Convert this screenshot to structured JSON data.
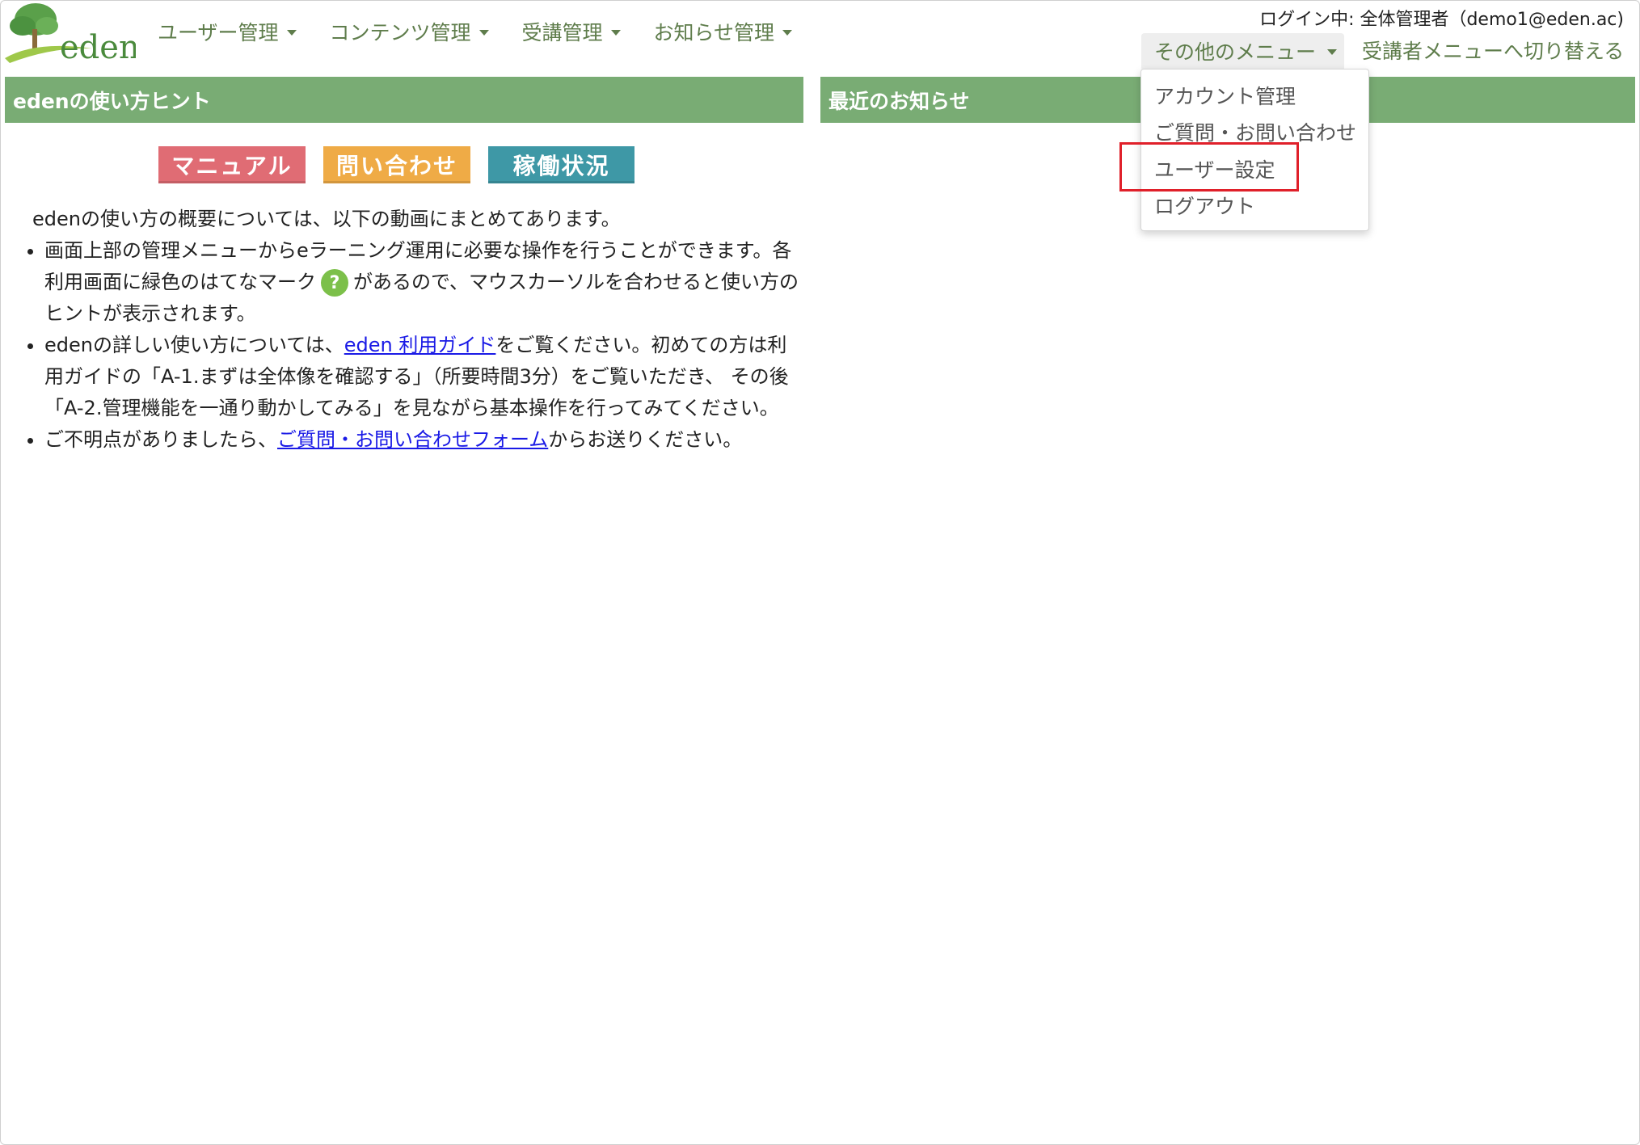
{
  "logo": {
    "text": "eden"
  },
  "nav": [
    {
      "label": "ユーザー管理"
    },
    {
      "label": "コンテンツ管理"
    },
    {
      "label": "受講管理"
    },
    {
      "label": "お知らせ管理"
    }
  ],
  "header": {
    "login_info": "ログイン中: 全体管理者（demo1@eden.ac)",
    "other_menu": "その他のメニュー",
    "switch_link": "受講者メニューへ切り替える"
  },
  "dropdown": {
    "items": [
      {
        "label": "アカウント管理"
      },
      {
        "label": "ご質問・お問い合わせ"
      },
      {
        "label": "ユーザー設定"
      },
      {
        "label": "ログアウト"
      }
    ]
  },
  "left_panel": {
    "title": "edenの使い方ヒント",
    "buttons": [
      {
        "label": "マニュアル",
        "color": "#e06c74"
      },
      {
        "label": "問い合わせ",
        "color": "#efab46"
      },
      {
        "label": "稼働状況",
        "color": "#3e98a6"
      }
    ],
    "intro": "edenの使い方の概要については、以下の動画にまとめてあります。",
    "bullet1": {
      "text_a": "画面上部の管理メニューからeラーニング運用に必要な操作を行うことができます。各利用画面に緑色のはてなマーク",
      "icon_glyph": "?",
      "text_b": "があるので、マウスカーソルを合わせると使い方のヒントが表示されます。"
    },
    "bullet2": {
      "text_a": "edenの詳しい使い方については、",
      "link": "eden 利用ガイド",
      "text_b": "をご覧ください。初めての方は利用ガイドの「A-1.まずは全体像を確認する」（所要時間3分）をご覧いただき、 その後「A-2.管理機能を一通り動かしてみる」を見ながら基本操作を行ってみてください。"
    },
    "bullet3": {
      "text_a": "ご不明点がありましたら、",
      "link": "ご質問・お問い合わせフォーム",
      "text_b": "からお送りください。"
    }
  },
  "right_panel": {
    "title": "最近のお知らせ"
  },
  "colors": {
    "header_green": "#79ac74",
    "nav_green": "#5f7d4c",
    "highlight_red": "#e0202a"
  }
}
